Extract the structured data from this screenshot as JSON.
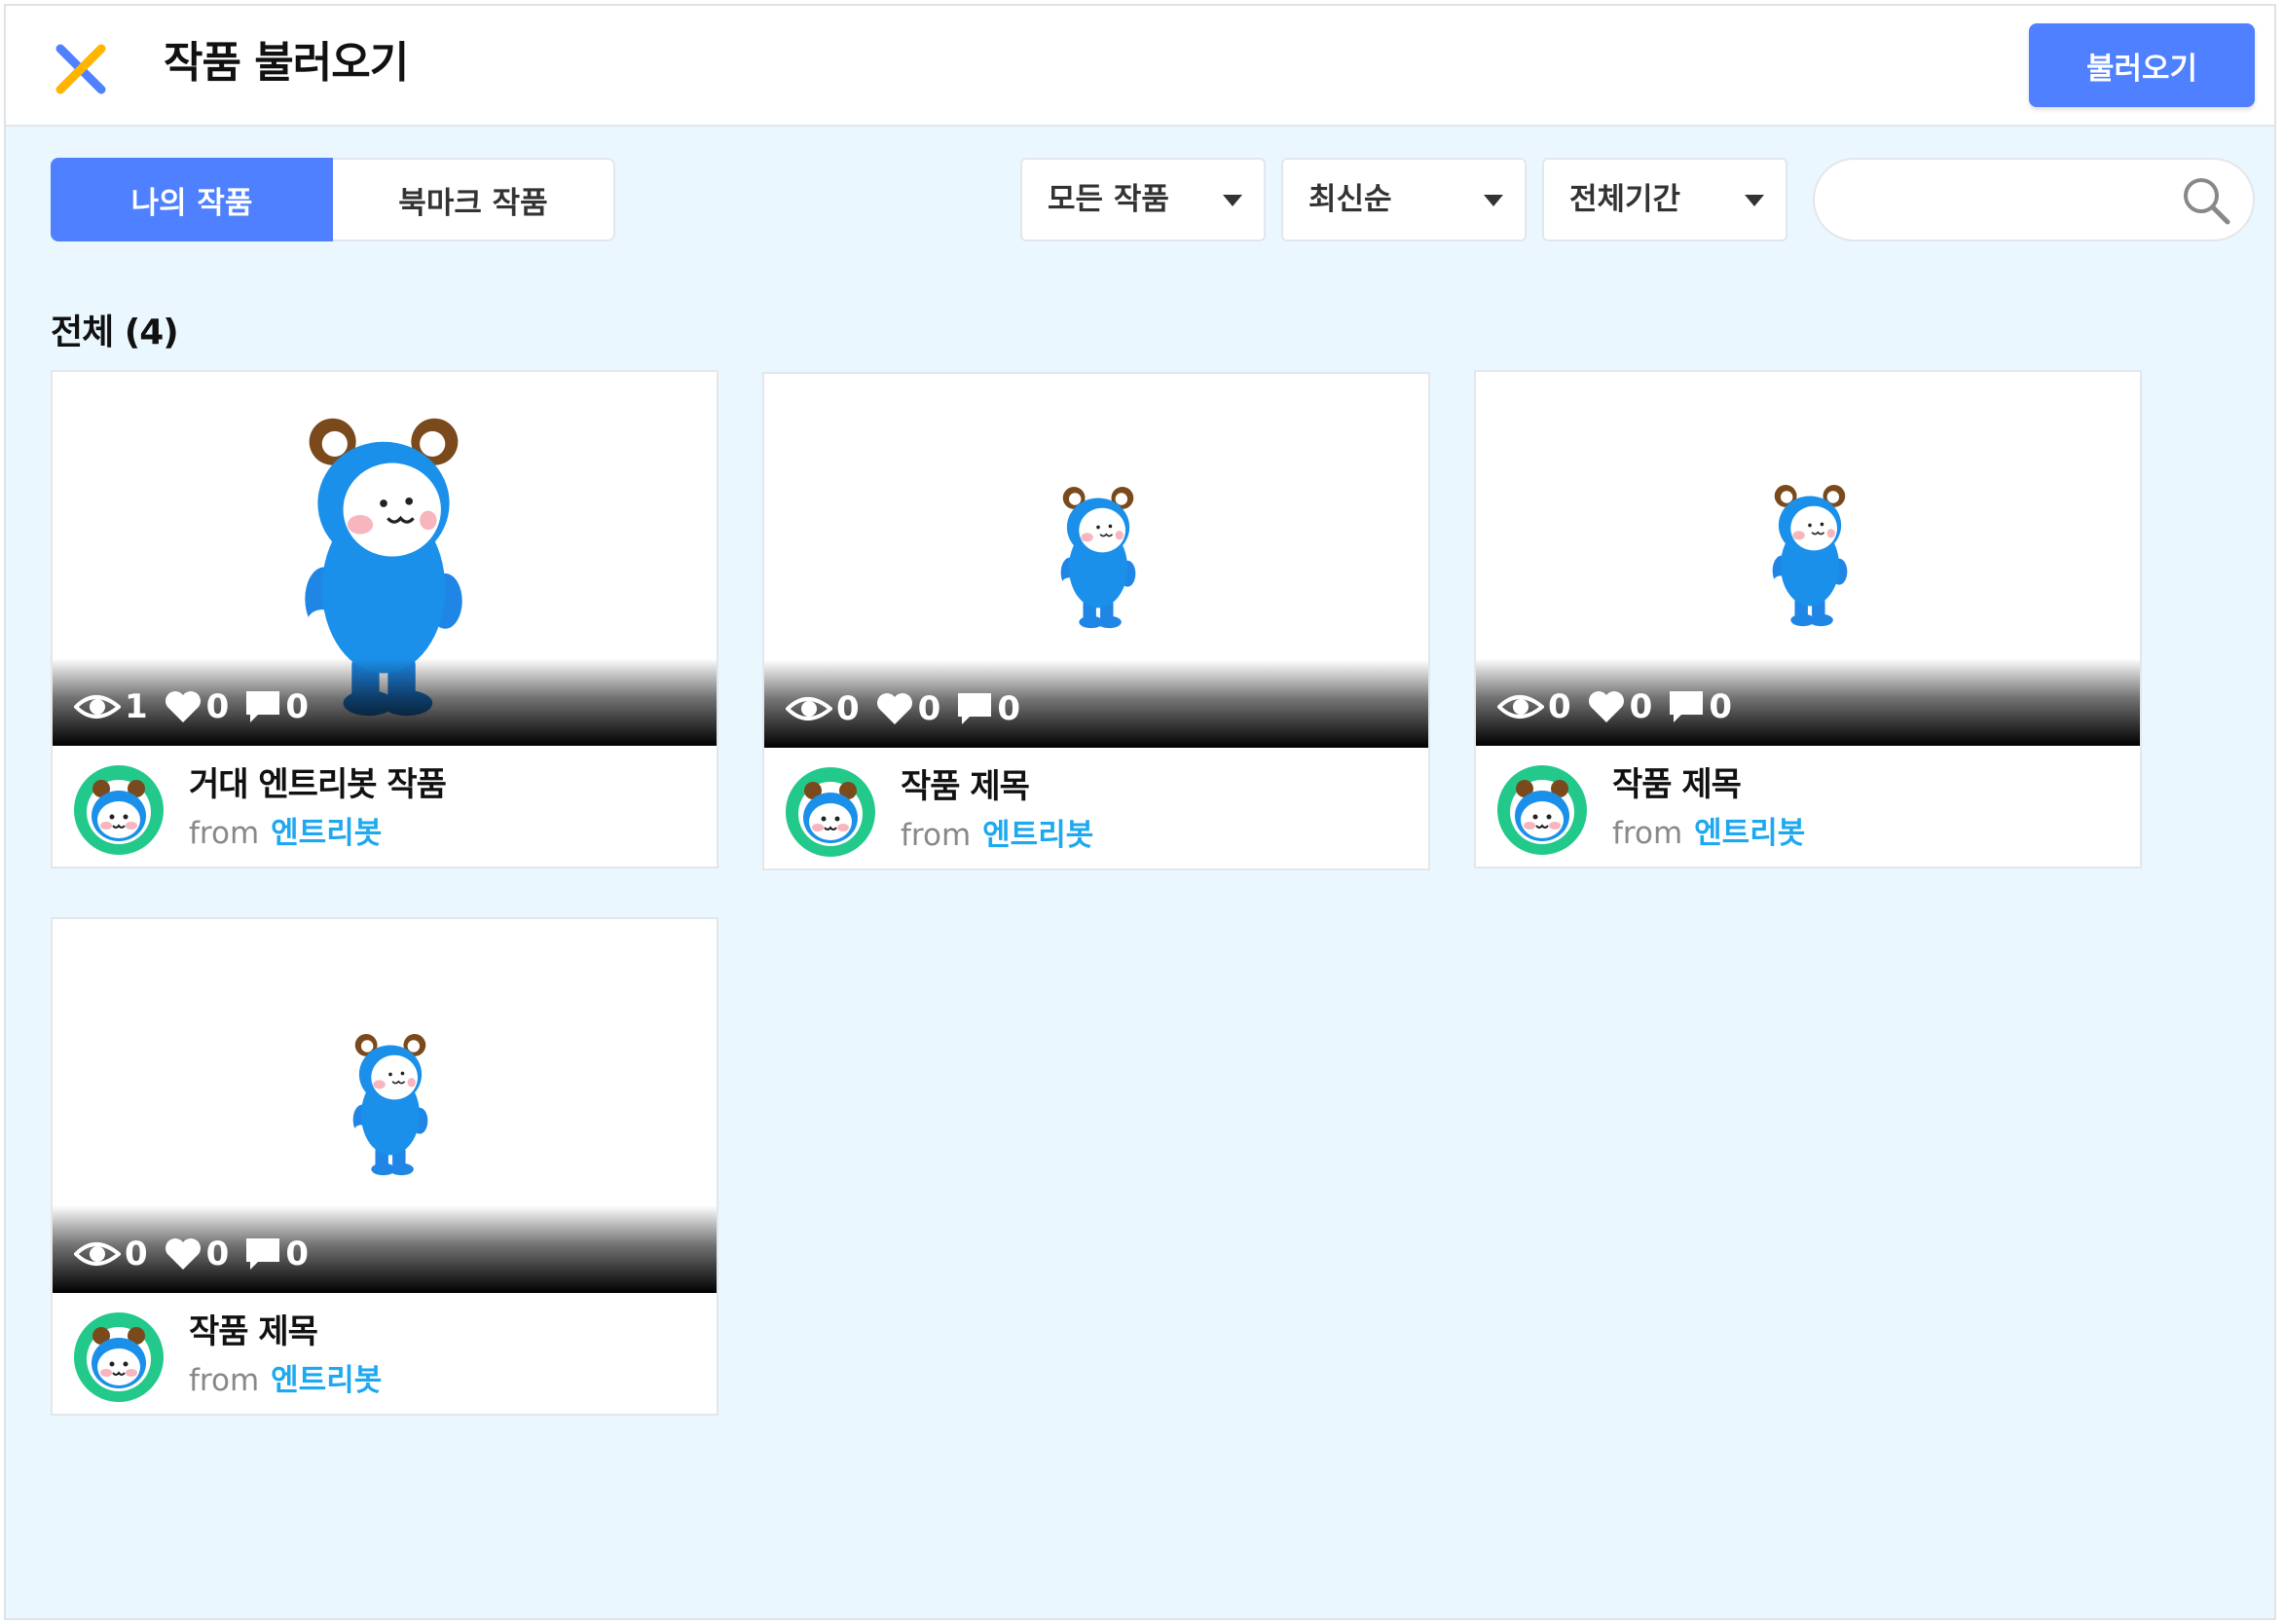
{
  "header": {
    "title": "작품 불러오기",
    "load_button": "불러오기",
    "logo_icon": "entry-x-logo-icon"
  },
  "tabs": [
    {
      "label": "나의 작품",
      "active": true
    },
    {
      "label": "북마크 작품",
      "active": false
    }
  ],
  "filters": {
    "category": "모든 작품",
    "sort": "최신순",
    "period": "전체기간"
  },
  "search": {
    "placeholder": "",
    "icon": "search-icon"
  },
  "list": {
    "count_label": "전체 (4)",
    "projects": [
      {
        "title": "거대 엔트리봇 작품",
        "from": "from",
        "author": "엔트리봇",
        "views": "1",
        "likes": "0",
        "comments": "0"
      },
      {
        "title": "작품 제목",
        "from": "from",
        "author": "엔트리봇",
        "views": "0",
        "likes": "0",
        "comments": "0"
      },
      {
        "title": "작품 제목",
        "from": "from",
        "author": "엔트리봇",
        "views": "0",
        "likes": "0",
        "comments": "0"
      },
      {
        "title": "작품 제목",
        "from": "from",
        "author": "엔트리봇",
        "views": "0",
        "likes": "0",
        "comments": "0"
      }
    ]
  },
  "colors": {
    "accent": "#4f80ff",
    "background": "#eaf7fe",
    "author_link": "#1ea8f0",
    "avatar_ring": "#22c98a"
  }
}
